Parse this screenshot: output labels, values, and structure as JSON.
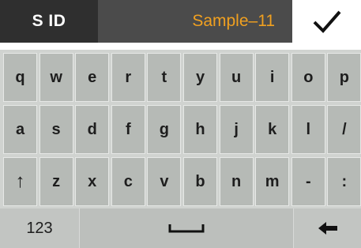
{
  "header": {
    "field_label": "S ID",
    "field_value": "Sample–11",
    "confirm_icon": "checkmark-icon",
    "value_color": "#f0a020"
  },
  "keyboard": {
    "rows": [
      [
        "q",
        "w",
        "e",
        "r",
        "t",
        "y",
        "u",
        "i",
        "o",
        "p"
      ],
      [
        "a",
        "s",
        "d",
        "f",
        "g",
        "h",
        "j",
        "k",
        "l",
        "/"
      ],
      [
        "↑",
        "z",
        "x",
        "c",
        "v",
        "b",
        "n",
        "m",
        "-",
        ":"
      ]
    ],
    "shift_icon": "shift-arrow-icon",
    "numbers_label": "123",
    "space_icon": "space-icon",
    "backspace_icon": "backspace-arrow-icon"
  }
}
